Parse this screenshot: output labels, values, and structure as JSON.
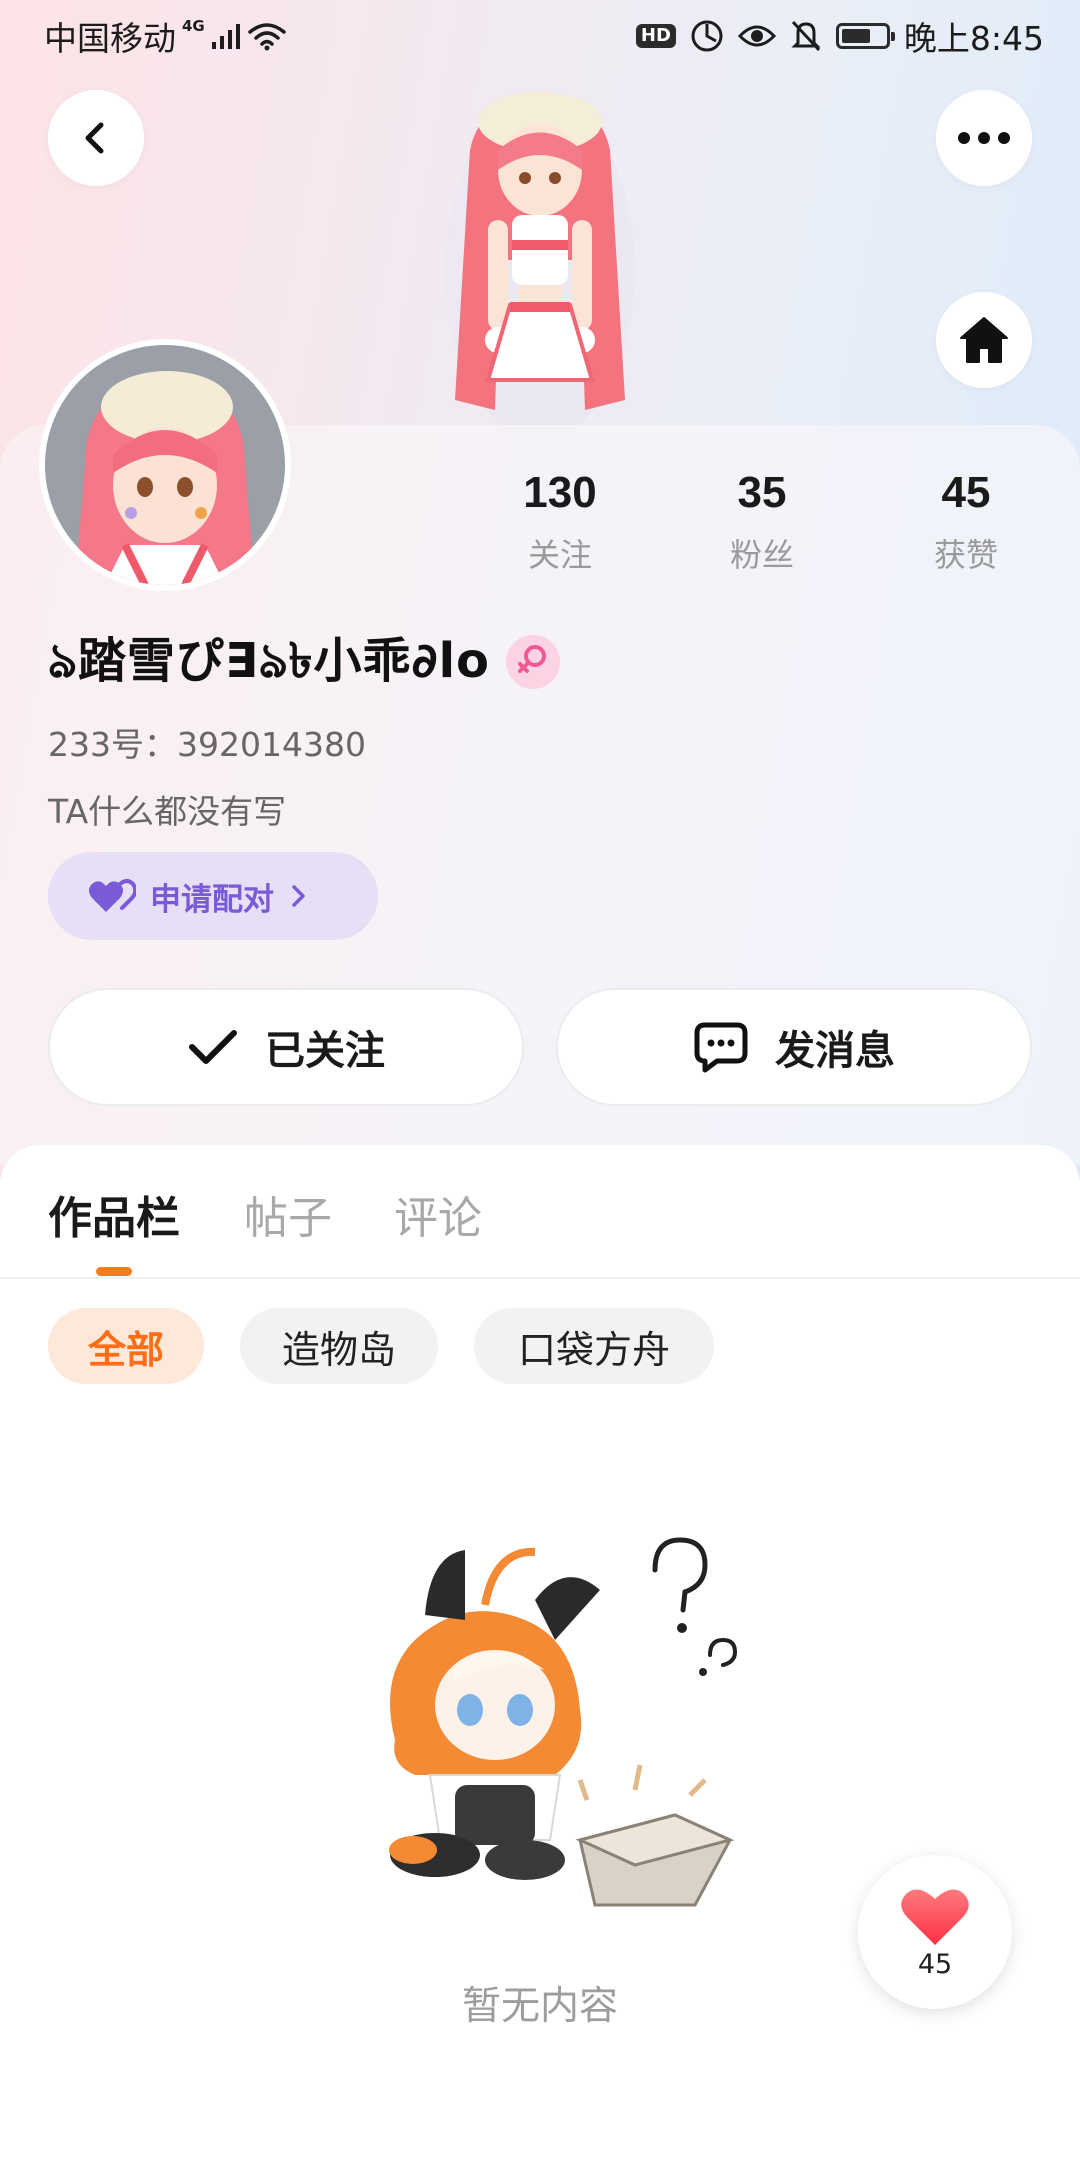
{
  "status_bar": {
    "carrier": "中国移动",
    "network": "4G",
    "hd": "HD",
    "time": "晚上8:45"
  },
  "profile": {
    "stats": [
      {
        "value": "130",
        "label": "关注"
      },
      {
        "value": "35",
        "label": "粉丝"
      },
      {
        "value": "45",
        "label": "获赞"
      }
    ],
    "nickname": "ঌ踏雪ぴ∃ঌ৳小乖∂lo",
    "uid": "233号：392014380",
    "bio": "TA什么都没有写",
    "pair_label": "申请配对",
    "followed_label": "已关注",
    "message_label": "发消息"
  },
  "tabs": [
    {
      "label": "作品栏",
      "active": true
    },
    {
      "label": "帖子",
      "active": false
    },
    {
      "label": "评论",
      "active": false
    }
  ],
  "filters": [
    {
      "label": "全部",
      "active": true
    },
    {
      "label": "造物岛",
      "active": false
    },
    {
      "label": "口袋方舟",
      "active": false
    }
  ],
  "empty_text": "暂无内容",
  "like_count": "45",
  "colors": {
    "accent": "#ff7a1c",
    "pair_text": "#7a5ad6",
    "pair_bg": "#e6dff6",
    "like_red": "#ff4a52"
  },
  "icons": [
    "back-icon",
    "more-icon",
    "home-icon",
    "female-icon",
    "heart-pair-icon",
    "check-icon",
    "chat-icon",
    "heart-icon"
  ]
}
